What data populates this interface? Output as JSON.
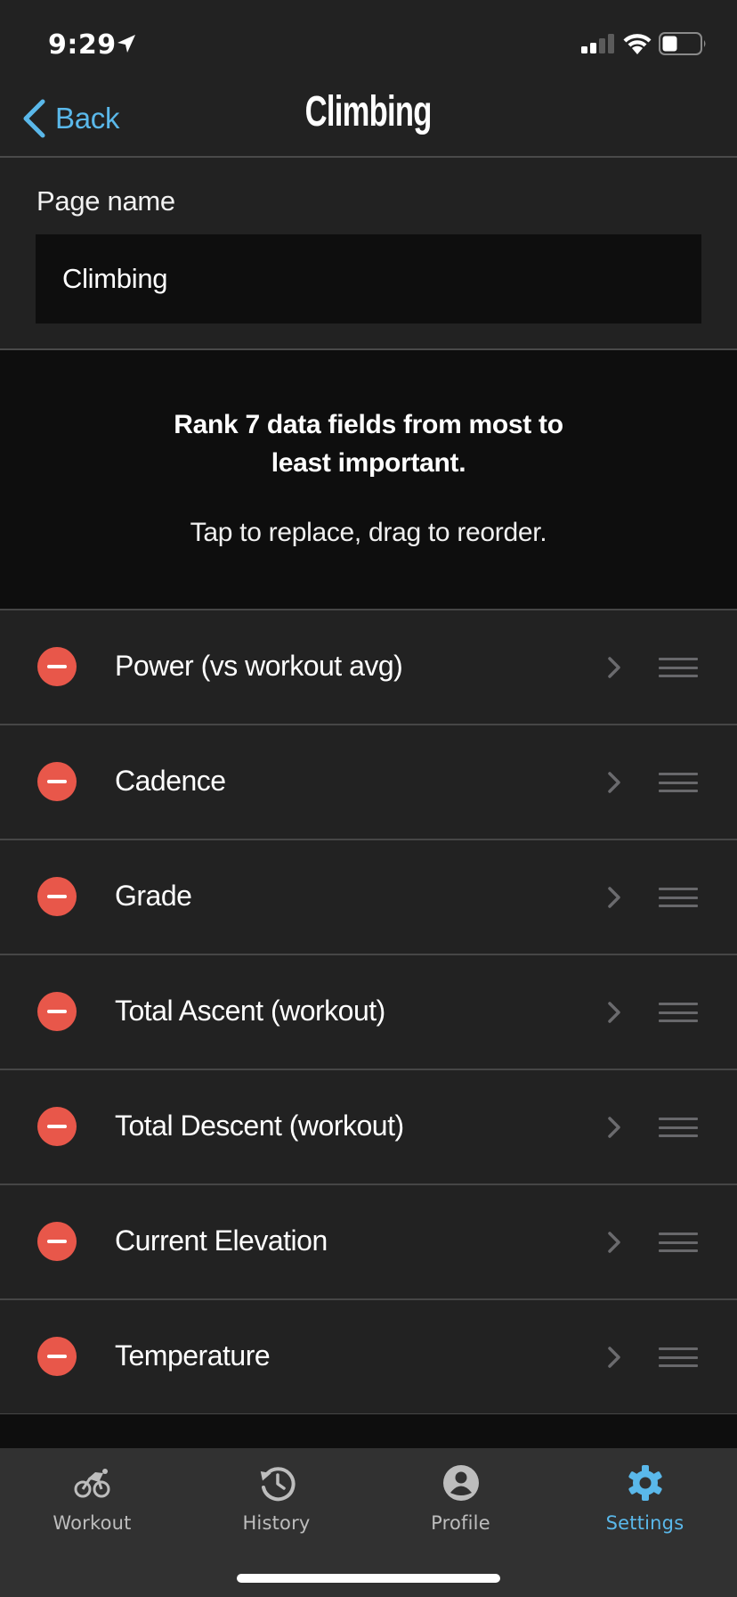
{
  "status_bar": {
    "time": "9:29",
    "location_icon": "location-arrow-icon",
    "signal_bars_active": 2,
    "signal_bars_total": 4,
    "battery_level": 0.4
  },
  "nav": {
    "back_label": "Back",
    "title": "Climbing"
  },
  "page_name": {
    "label": "Page name",
    "value": "Climbing"
  },
  "instructions": {
    "line1": "Rank 7 data fields from most to",
    "line2": "least important.",
    "hint": "Tap to replace, drag to reorder."
  },
  "fields": [
    {
      "label": "Power (vs workout avg)"
    },
    {
      "label": "Cadence"
    },
    {
      "label": "Grade"
    },
    {
      "label": "Total Ascent (workout)"
    },
    {
      "label": "Total Descent (workout)"
    },
    {
      "label": "Current Elevation"
    },
    {
      "label": "Temperature"
    }
  ],
  "tabbar": {
    "tabs": [
      {
        "label": "Workout",
        "icon": "bicycle-icon",
        "active": false
      },
      {
        "label": "History",
        "icon": "history-icon",
        "active": false
      },
      {
        "label": "Profile",
        "icon": "profile-icon",
        "active": false
      },
      {
        "label": "Settings",
        "icon": "gear-icon",
        "active": true
      }
    ]
  },
  "colors": {
    "accent": "#5ab8ea",
    "delete": "#e8574a",
    "background": "#222222",
    "field_background": "#0e0e0e",
    "tabbar_background": "#313131",
    "inactive_tab": "#bdbdbd"
  }
}
